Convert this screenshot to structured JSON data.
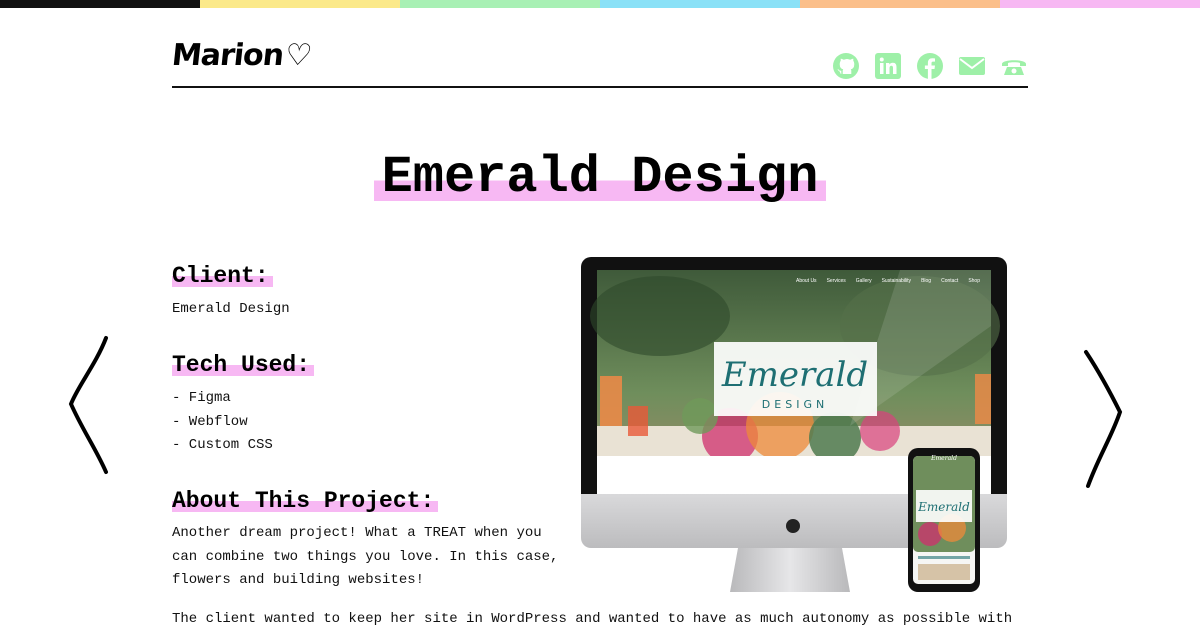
{
  "stripes": [
    "#111111",
    "#fbe98a",
    "#a8f0b4",
    "#8ae1f7",
    "#fbbf8a",
    "#f7b8f3"
  ],
  "accent_color": "#f7b8f3",
  "icon_color": "#9ef0a8",
  "logo": {
    "text": "Marion",
    "heart": "♡"
  },
  "social": [
    {
      "name": "github-icon"
    },
    {
      "name": "linkedin-icon"
    },
    {
      "name": "facebook-icon"
    },
    {
      "name": "mail-icon"
    },
    {
      "name": "phone-icon"
    }
  ],
  "project": {
    "title": "Emerald Design",
    "client_heading": "Client:",
    "client": "Emerald Design",
    "tech_heading": "Tech Used:",
    "tech": [
      "- Figma",
      "- Webflow",
      "- Custom CSS"
    ],
    "about_heading": "About This Project:",
    "about_lines": [
      "Another dream project! What a TREAT when you",
      "can combine two things you love. In this case,",
      "flowers and building websites!"
    ],
    "description_line": "The client wanted to keep her site in WordPress and wanted to have as much autonomy as possible with"
  },
  "mockup": {
    "brand_script": "Emerald",
    "brand_sub": "DESIGN",
    "menu": [
      "About Us",
      "Services",
      "Gallery",
      "Sustainability",
      "Blog",
      "Contact",
      "Shop"
    ]
  },
  "nav": {
    "prev": "previous-project",
    "next": "next-project"
  }
}
